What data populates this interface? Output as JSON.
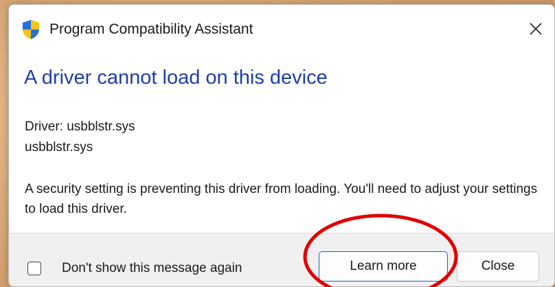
{
  "window": {
    "title": "Program Compatibility Assistant",
    "icon": "shield-icon",
    "close_icon": "close-icon"
  },
  "content": {
    "heading": "A driver cannot load on this device",
    "driver_line": "Driver: usbblstr.sys",
    "driver_name": "usbblstr.sys",
    "message": "A security setting is preventing this driver from loading. You'll need to adjust your settings to load this driver."
  },
  "footer": {
    "checkbox_label": "Don't show this message again",
    "checkbox_checked": false,
    "learn_more_label": "Learn more",
    "close_label": "Close"
  },
  "colors": {
    "heading": "#1f3ea6",
    "annotation": "#e00000",
    "shield_blue": "#2b6fd6",
    "shield_yellow": "#f5c518"
  }
}
